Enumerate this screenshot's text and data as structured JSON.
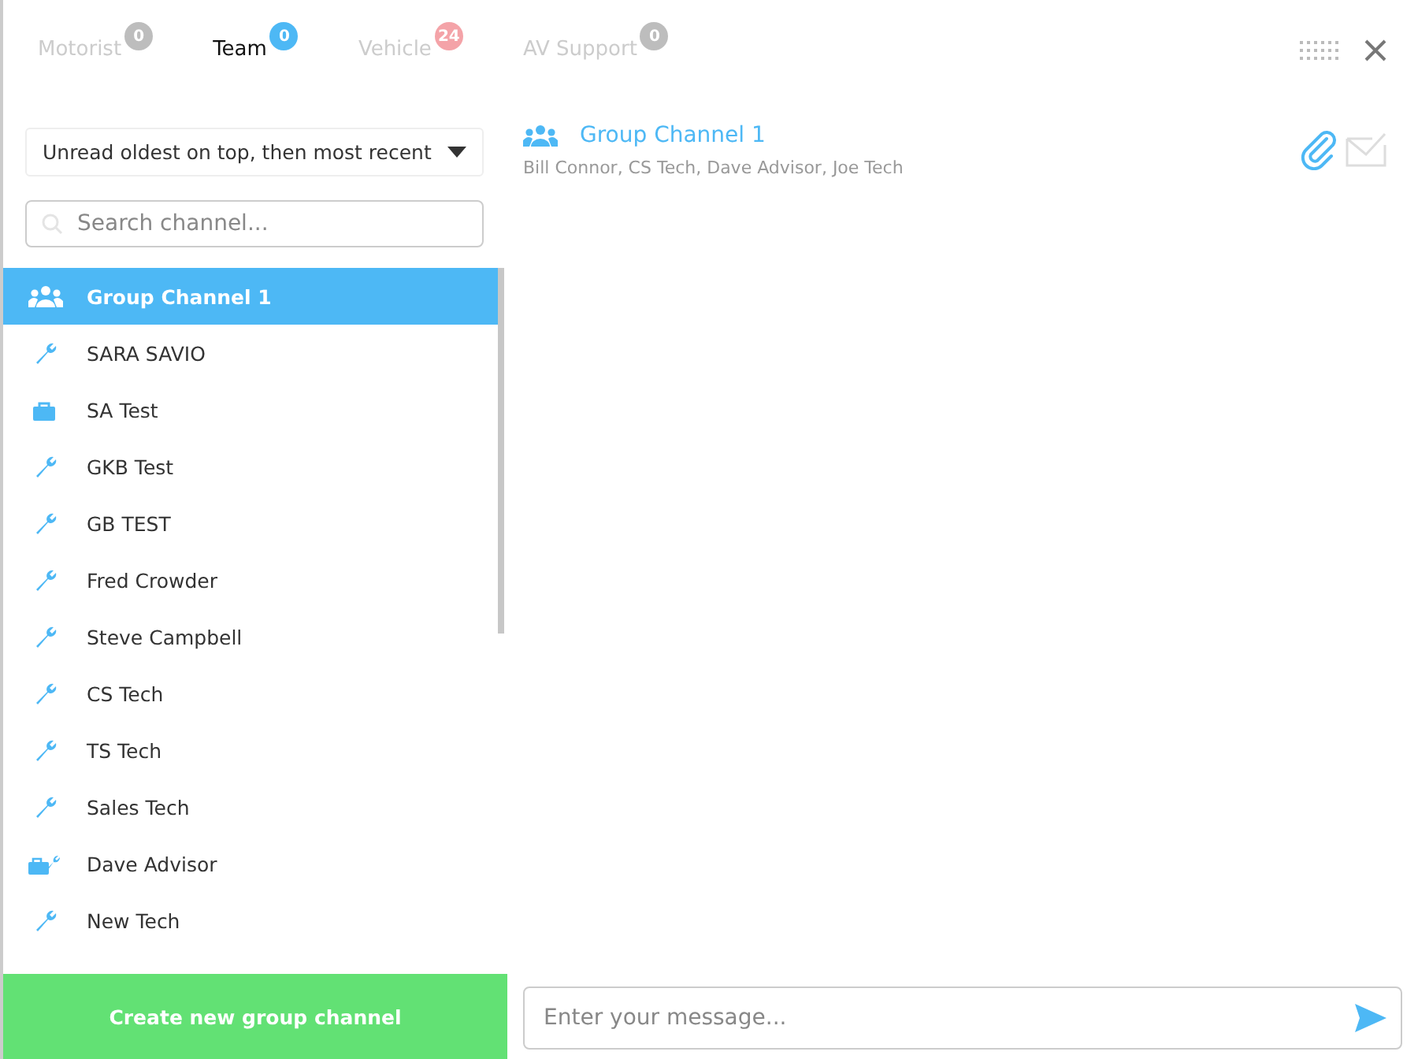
{
  "tabs": [
    {
      "label": "Motorist",
      "badge": "0",
      "color": "#bdbdbd",
      "selected": false
    },
    {
      "label": "Team",
      "badge": "0",
      "color": "#4db8f5",
      "selected": true
    },
    {
      "label": "Vehicle",
      "badge": "24",
      "color": "#f4a3a8",
      "selected": false
    },
    {
      "label": "AV Support",
      "badge": "0",
      "color": "#bdbdbd",
      "selected": false
    }
  ],
  "sort": {
    "value": "Unread oldest on top, then most recent"
  },
  "search": {
    "placeholder": "Search channel..."
  },
  "channels": [
    {
      "name": "Group Channel 1",
      "kind": "group",
      "selected": true
    },
    {
      "name": "SARA SAVIO",
      "kind": "tech",
      "selected": false
    },
    {
      "name": "SA Test",
      "kind": "advisor",
      "selected": false
    },
    {
      "name": "GKB Test",
      "kind": "tech",
      "selected": false
    },
    {
      "name": "GB TEST",
      "kind": "tech",
      "selected": false
    },
    {
      "name": "Fred Crowder",
      "kind": "tech",
      "selected": false
    },
    {
      "name": "Steve Campbell",
      "kind": "tech",
      "selected": false
    },
    {
      "name": "CS Tech",
      "kind": "tech",
      "selected": false
    },
    {
      "name": "TS Tech",
      "kind": "tech",
      "selected": false
    },
    {
      "name": "Sales Tech",
      "kind": "tech",
      "selected": false
    },
    {
      "name": "Dave Advisor",
      "kind": "both",
      "selected": false
    },
    {
      "name": "New Tech",
      "kind": "tech",
      "selected": false
    }
  ],
  "create_button": "Create new group channel",
  "conversation": {
    "title": "Group Channel 1",
    "members": "Bill Connor, CS Tech, Dave Advisor, Joe Tech"
  },
  "composer": {
    "placeholder": "Enter your message..."
  }
}
